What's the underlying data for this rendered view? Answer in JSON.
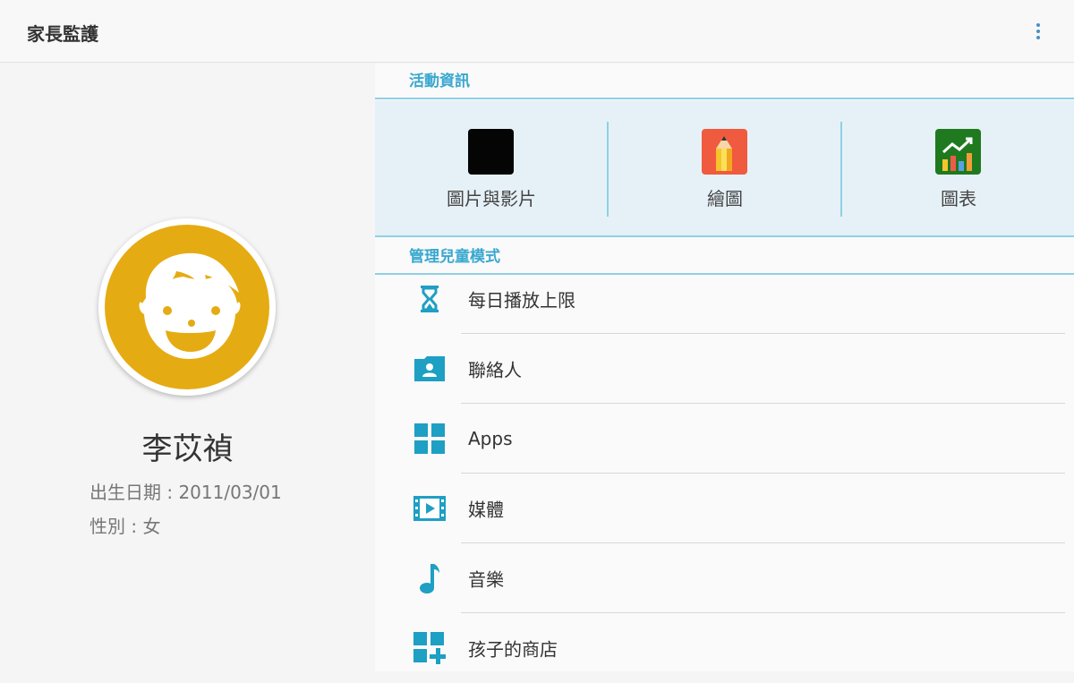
{
  "header": {
    "title": "家長監護",
    "more_icon": "more-vert-icon"
  },
  "profile": {
    "name": "李苡禎",
    "birthdate": "出生日期 : 2011/03/01",
    "gender": "性別 : 女",
    "avatar_icon": "child-face-icon",
    "avatar_color": "#e5ab12"
  },
  "activity_section": {
    "title": "活動資訊",
    "items": [
      {
        "label": "圖片與影片",
        "icon": "photos-videos-icon"
      },
      {
        "label": "繪圖",
        "icon": "drawing-pencil-icon"
      },
      {
        "label": "圖表",
        "icon": "chart-icon"
      }
    ]
  },
  "manage_section": {
    "title": "管理兒童模式",
    "items": [
      {
        "label": "每日播放上限",
        "icon": "hourglass-icon"
      },
      {
        "label": "聯絡人",
        "icon": "contacts-icon"
      },
      {
        "label": "Apps",
        "icon": "apps-grid-icon"
      },
      {
        "label": "媒體",
        "icon": "media-video-icon"
      },
      {
        "label": "音樂",
        "icon": "music-note-icon"
      },
      {
        "label": "孩子的商店",
        "icon": "store-add-icon"
      }
    ]
  },
  "colors": {
    "accent": "#3aa8cf",
    "icon_teal": "#1e9fc4",
    "activity_bg": "#e6f1f7"
  }
}
